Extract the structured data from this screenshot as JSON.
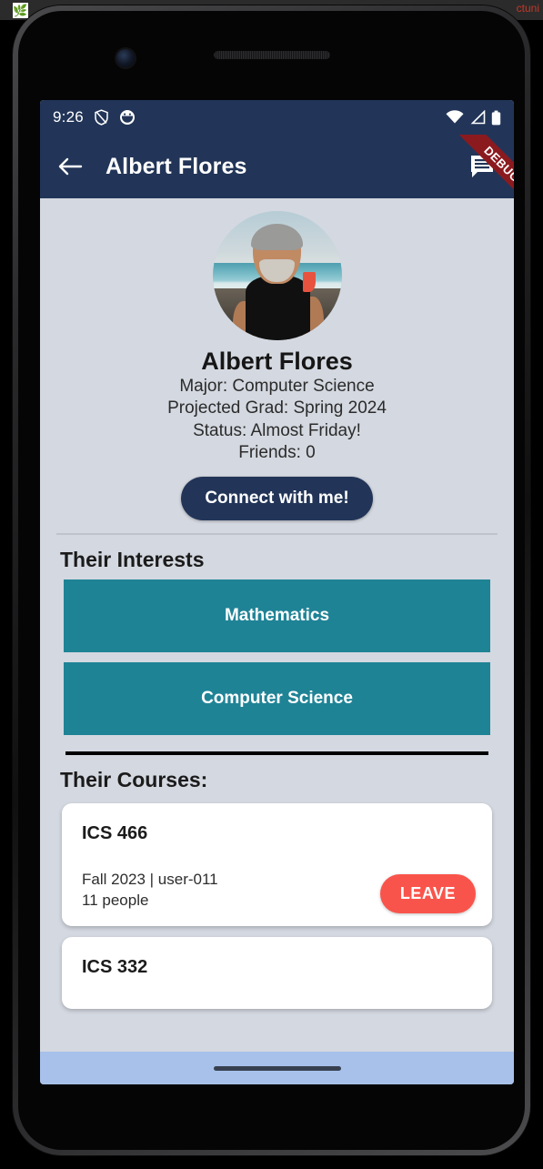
{
  "browser": {
    "favicon": "leaf-icon",
    "tab_title_right": "ctuni"
  },
  "device": {
    "camera": "front-camera",
    "speaker": "speaker-grille"
  },
  "status_bar": {
    "time": "9:26",
    "left_icons": [
      "shield-icon",
      "face-icon"
    ],
    "right_icons": [
      "wifi-icon",
      "signal-icon",
      "battery-icon"
    ],
    "background": "#223558"
  },
  "app_bar": {
    "back_icon": "back-arrow-icon",
    "title": "Albert Flores",
    "chat_icon": "chat-icon",
    "background": "#223558"
  },
  "debug_ribbon": {
    "label": "DEBUG",
    "color": "#8b1a1f"
  },
  "profile": {
    "avatar": "profile-photo",
    "name": "Albert Flores",
    "major": "Major: Computer Science",
    "projected_grad": "Projected Grad: Spring 2024",
    "status": "Status: Almost Friday!",
    "friends": "Friends: 0",
    "connect_button": "Connect with me!"
  },
  "interests": {
    "title": "Their Interests",
    "accent": "#1f8396",
    "items": [
      {
        "label": "Mathematics"
      },
      {
        "label": "Computer Science"
      }
    ]
  },
  "courses": {
    "title": "Their Courses:",
    "leave_label": "LEAVE",
    "leave_color": "#f9544b",
    "items": [
      {
        "code": "ICS 466",
        "meta": "Fall 2023 | user-011",
        "people": "11 people",
        "action": "LEAVE"
      },
      {
        "code": "ICS 332",
        "meta": "",
        "people": "",
        "action": ""
      }
    ]
  },
  "nav_bar": {
    "home_indicator": "home-indicator",
    "background": "#a7c1ea"
  }
}
